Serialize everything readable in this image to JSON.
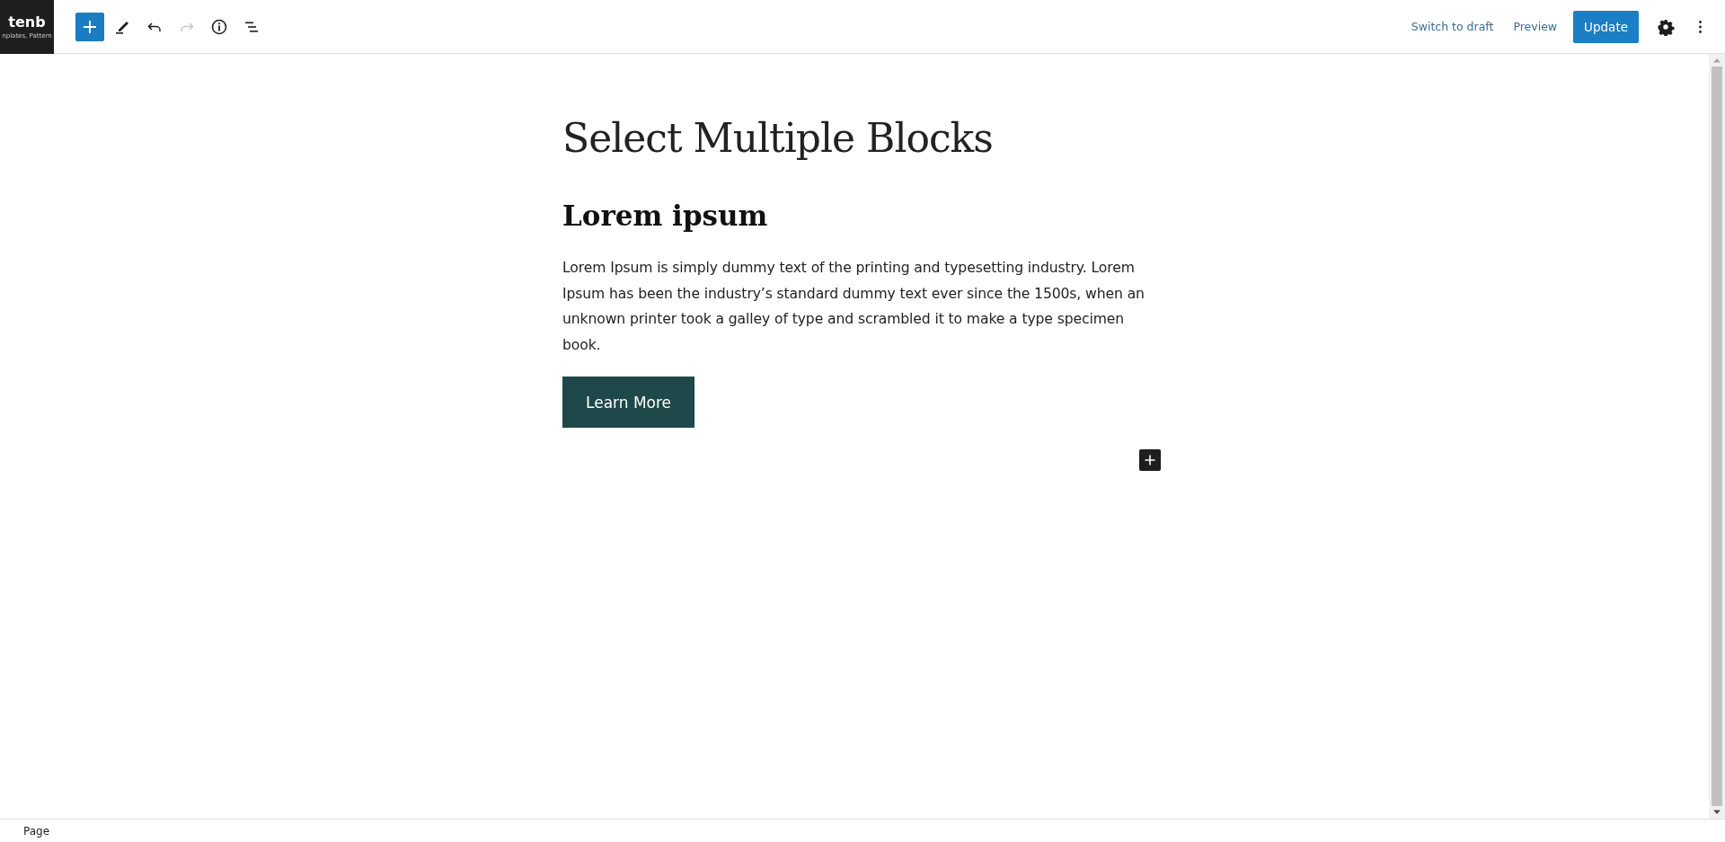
{
  "logo": {
    "name": "tenb",
    "tagline": "nplates, Pattern"
  },
  "toolbar": {
    "tools": [
      {
        "kind": "add",
        "disabled": false
      },
      {
        "kind": "edit",
        "disabled": false
      },
      {
        "kind": "undo",
        "disabled": false
      },
      {
        "kind": "redo",
        "disabled": true
      },
      {
        "kind": "info",
        "disabled": false
      },
      {
        "kind": "list",
        "disabled": false
      }
    ],
    "actions": [
      "Switch to draft",
      "Preview"
    ],
    "primary": "Update"
  },
  "content": {
    "title": "Select Multiple Blocks",
    "heading": "Lorem ipsum",
    "paragraph": "Lorem Ipsum is simply dummy text of the printing and typesetting industry. Lorem Ipsum has been the industry’s standard dummy text ever since the 1500s, when an unknown printer took a galley of type and scrambled it to make a type specimen book.",
    "button": "Learn More"
  },
  "status_bar": {
    "breadcrumb": "Page"
  }
}
